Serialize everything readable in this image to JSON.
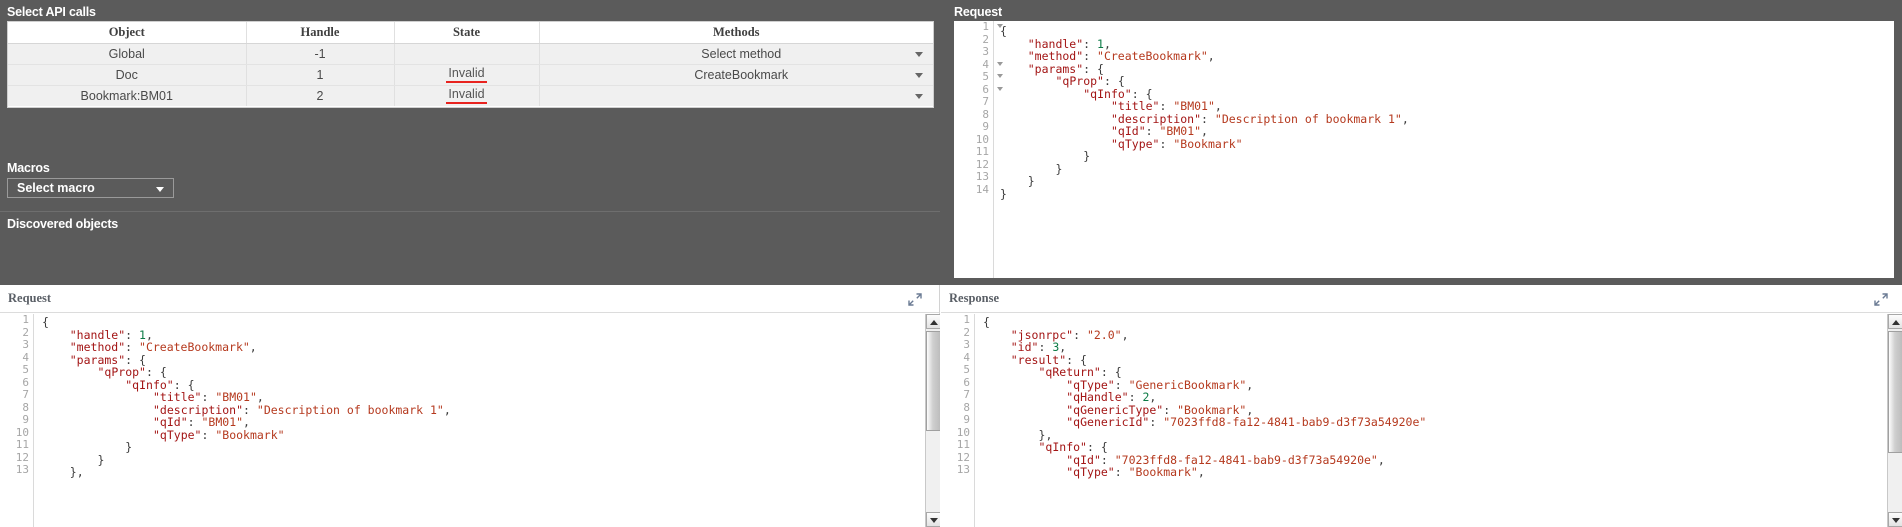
{
  "top_left": {
    "section_title": "Select API calls",
    "table": {
      "headers": [
        "Object",
        "Handle",
        "State",
        "Methods"
      ],
      "rows": [
        {
          "object": "Global",
          "handle": "-1",
          "state": "",
          "method": "Select method"
        },
        {
          "object": "Doc",
          "handle": "1",
          "state": "Invalid",
          "method": "CreateBookmark"
        },
        {
          "object": "Bookmark:BM01",
          "handle": "2",
          "state": "Invalid",
          "method": ""
        }
      ]
    },
    "macros": {
      "label": "Macros",
      "selected": "Select macro"
    },
    "discovered_objects_label": "Discovered objects"
  },
  "top_right": {
    "title": "Request",
    "lines": [
      {
        "n": "1",
        "fold": true,
        "text": "{"
      },
      {
        "n": "2",
        "fold": false,
        "text": "    \"handle\": 1,"
      },
      {
        "n": "3",
        "fold": false,
        "text": "    \"method\": \"CreateBookmark\","
      },
      {
        "n": "4",
        "fold": true,
        "text": "    \"params\": {"
      },
      {
        "n": "5",
        "fold": true,
        "text": "        \"qProp\": {"
      },
      {
        "n": "6",
        "fold": true,
        "text": "            \"qInfo\": {"
      },
      {
        "n": "7",
        "fold": false,
        "text": "                \"title\": \"BM01\","
      },
      {
        "n": "8",
        "fold": false,
        "text": "                \"description\": \"Description of bookmark 1\","
      },
      {
        "n": "9",
        "fold": false,
        "text": "                \"qId\": \"BM01\","
      },
      {
        "n": "10",
        "fold": false,
        "text": "                \"qType\": \"Bookmark\""
      },
      {
        "n": "11",
        "fold": false,
        "text": "            }"
      },
      {
        "n": "12",
        "fold": false,
        "text": "        }"
      },
      {
        "n": "13",
        "fold": false,
        "text": "    }"
      },
      {
        "n": "14",
        "fold": false,
        "text": "}"
      }
    ]
  },
  "bottom_left": {
    "title": "Request",
    "expand_icon": "expand-icon",
    "lines": [
      {
        "n": "1",
        "text": "{"
      },
      {
        "n": "2",
        "text": "    \"handle\": 1,"
      },
      {
        "n": "3",
        "text": "    \"method\": \"CreateBookmark\","
      },
      {
        "n": "4",
        "text": "    \"params\": {"
      },
      {
        "n": "5",
        "text": "        \"qProp\": {"
      },
      {
        "n": "6",
        "text": "            \"qInfo\": {"
      },
      {
        "n": "7",
        "text": "                \"title\": \"BM01\","
      },
      {
        "n": "8",
        "text": "                \"description\": \"Description of bookmark 1\","
      },
      {
        "n": "9",
        "text": "                \"qId\": \"BM01\","
      },
      {
        "n": "10",
        "text": "                \"qType\": \"Bookmark\""
      },
      {
        "n": "11",
        "text": "            }"
      },
      {
        "n": "12",
        "text": "        }"
      },
      {
        "n": "13",
        "text": "    },"
      }
    ]
  },
  "bottom_right": {
    "title": "Response",
    "expand_icon": "expand-icon",
    "lines": [
      {
        "n": "1",
        "text": "{"
      },
      {
        "n": "2",
        "text": "    \"jsonrpc\": \"2.0\","
      },
      {
        "n": "3",
        "text": "    \"id\": 3,"
      },
      {
        "n": "4",
        "text": "    \"result\": {"
      },
      {
        "n": "5",
        "text": "        \"qReturn\": {"
      },
      {
        "n": "6",
        "text": "            \"qType\": \"GenericBookmark\","
      },
      {
        "n": "7",
        "text": "            \"qHandle\": 2,"
      },
      {
        "n": "8",
        "text": "            \"qGenericType\": \"Bookmark\","
      },
      {
        "n": "9",
        "text": "            \"qGenericId\": \"7023ffd8-fa12-4841-bab9-d3f73a54920e\""
      },
      {
        "n": "10",
        "text": "        },"
      },
      {
        "n": "11",
        "text": "        \"qInfo\": {"
      },
      {
        "n": "12",
        "text": "            \"qId\": \"7023ffd8-fa12-4841-bab9-d3f73a54920e\","
      },
      {
        "n": "13",
        "text": "            \"qType\": \"Bookmark\","
      }
    ]
  },
  "colors": {
    "chrome_bg": "#5b5b5b",
    "panel_bg": "#ffffff",
    "row_bg": "#f0f0f0",
    "invalid_underline": "#e8231f",
    "json_key": "#a31515",
    "json_string": "#b5391e",
    "json_number": "#0b7a45"
  }
}
